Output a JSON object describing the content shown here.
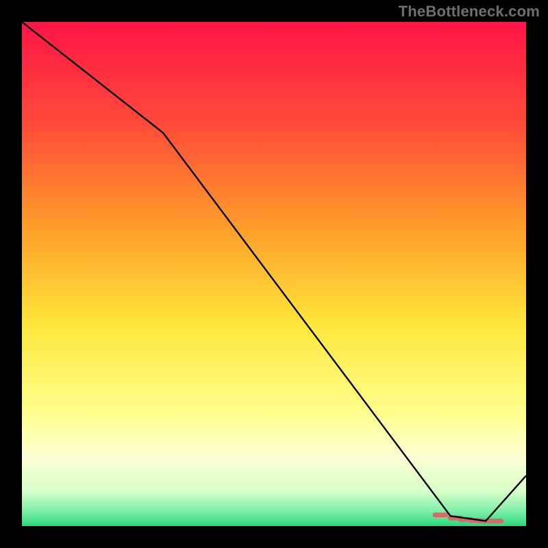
{
  "attribution": "TheBottleneck.com",
  "chart_data": {
    "type": "line",
    "title": "",
    "xlabel": "",
    "ylabel": "",
    "xlim": [
      0,
      100
    ],
    "ylim": [
      0,
      100
    ],
    "background_gradient": {
      "stops": [
        {
          "offset": 0.0,
          "color": "#ff1447"
        },
        {
          "offset": 0.2,
          "color": "#ff4a3a"
        },
        {
          "offset": 0.4,
          "color": "#ff9a2a"
        },
        {
          "offset": 0.6,
          "color": "#ffe63a"
        },
        {
          "offset": 0.78,
          "color": "#ffff90"
        },
        {
          "offset": 0.86,
          "color": "#fdffd2"
        },
        {
          "offset": 0.93,
          "color": "#d8ffca"
        },
        {
          "offset": 0.97,
          "color": "#7ef0a8"
        },
        {
          "offset": 1.0,
          "color": "#28d97e"
        }
      ]
    },
    "series": [
      {
        "name": "bottleneck-curve",
        "color": "#000000",
        "x": [
          0,
          28,
          85,
          92,
          100
        ],
        "y": [
          100,
          78,
          2,
          1,
          10
        ]
      }
    ],
    "highlight": {
      "name": "flat-region-marker",
      "color": "#d66b66",
      "x": [
        83,
        86,
        88,
        90,
        92,
        94
      ],
      "y": [
        2.2,
        1.6,
        1.3,
        1.1,
        1.0,
        1.0
      ]
    }
  }
}
